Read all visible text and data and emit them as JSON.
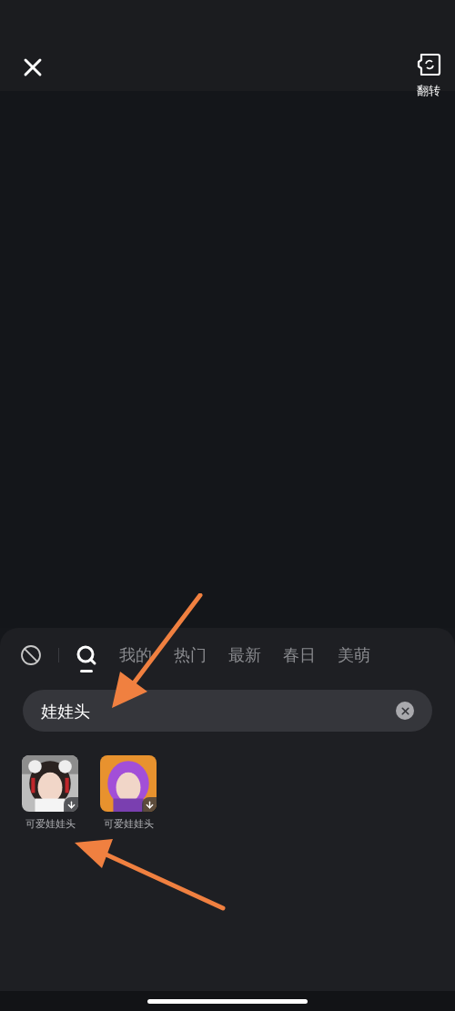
{
  "top_bar": {
    "flip_label": "翻转"
  },
  "tabs": [
    {
      "kind": "none",
      "selected": false
    },
    {
      "kind": "search",
      "selected": true
    },
    {
      "kind": "text",
      "label": "我的",
      "selected": false
    },
    {
      "kind": "text",
      "label": "热门",
      "selected": false
    },
    {
      "kind": "text",
      "label": "最新",
      "selected": false
    },
    {
      "kind": "text",
      "label": "春日",
      "selected": false
    },
    {
      "kind": "text",
      "label": "美萌",
      "selected": false
    }
  ],
  "search": {
    "value": "娃娃头"
  },
  "results": [
    {
      "name": "可爱娃娃头",
      "kind": "picture"
    },
    {
      "name": "可爱娃娃头",
      "kind": "picture"
    }
  ]
}
